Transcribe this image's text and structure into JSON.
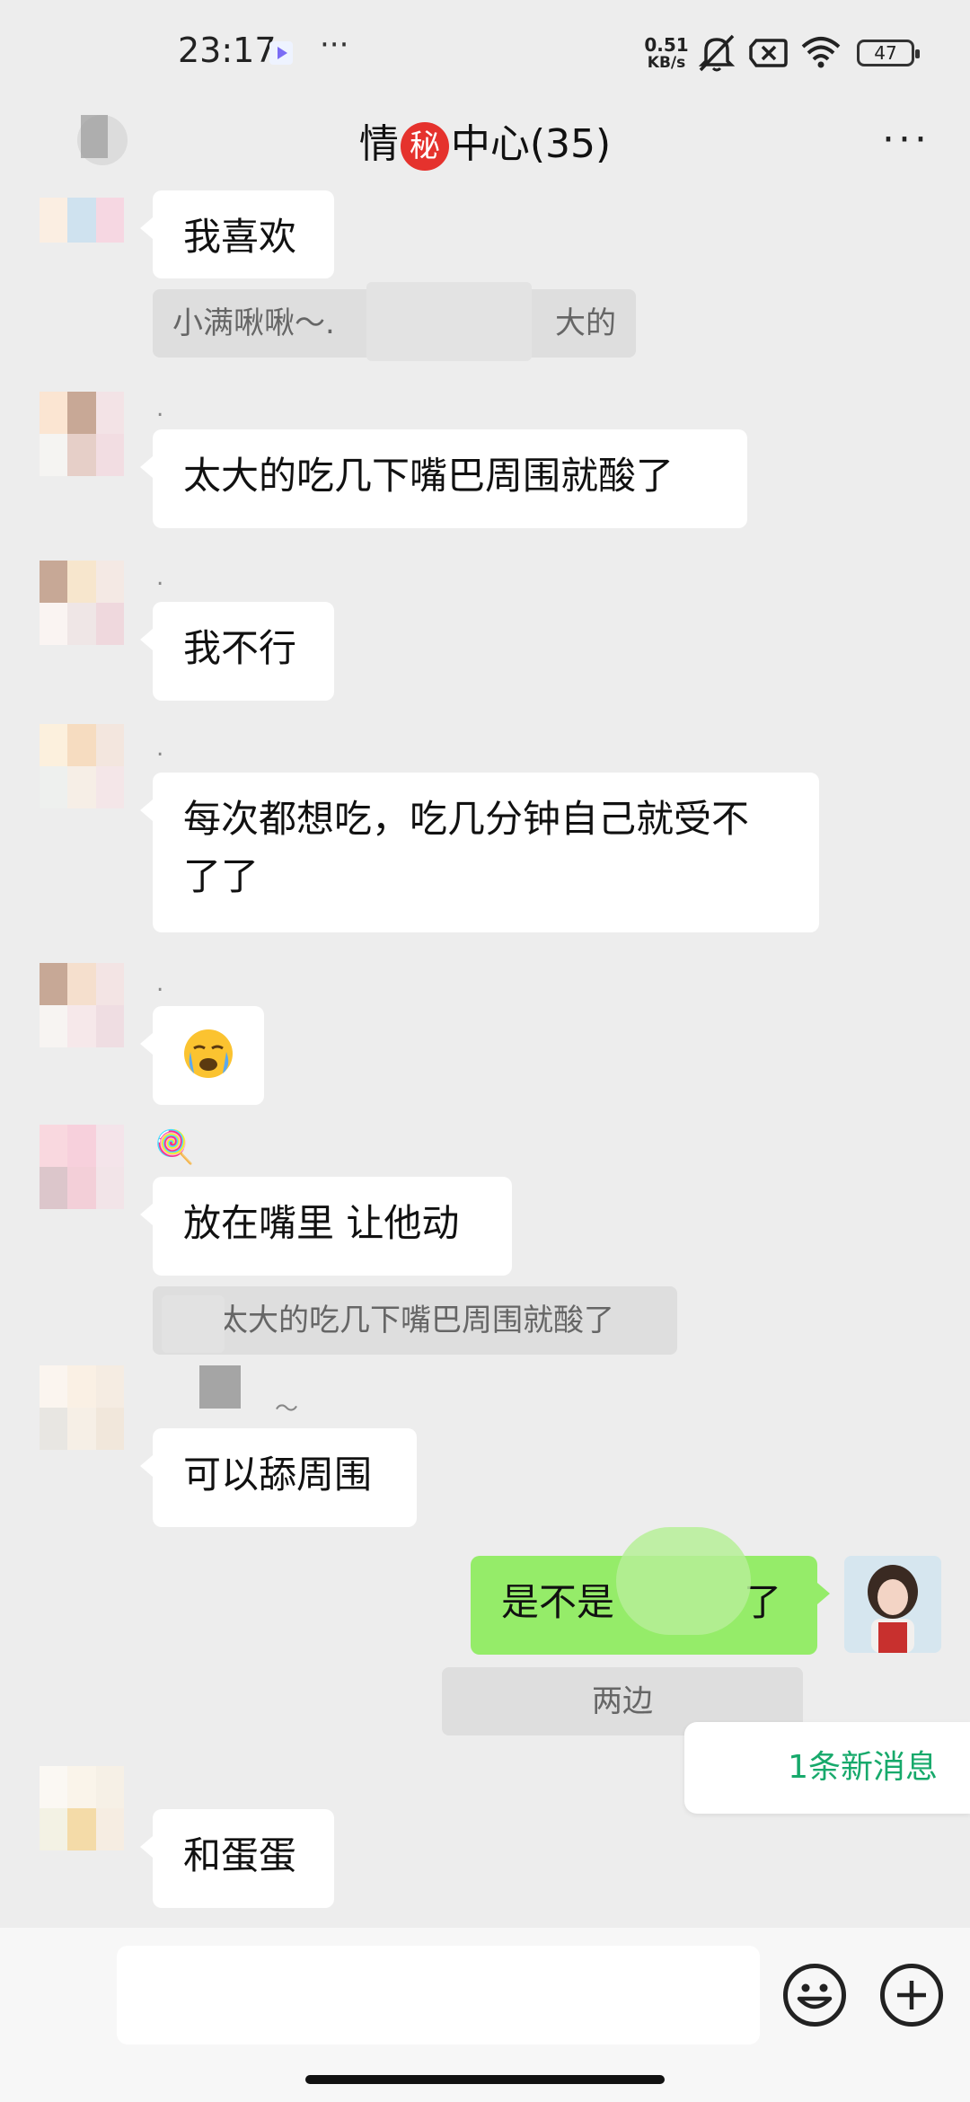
{
  "status_bar": {
    "time": "23:17",
    "more": "···",
    "net_speed_value": "0.51",
    "net_speed_unit": "KB/s",
    "battery": "47"
  },
  "header": {
    "title_left": "情",
    "title_badge": "秘",
    "title_right": "中心(35)",
    "more": "···"
  },
  "messages": [
    {
      "text": "我喜欢"
    },
    {
      "quote_left": "小满啾啾～.",
      "quote_right": "大的"
    },
    {
      "nick": ".",
      "text": "太大的吃几下嘴巴周围就酸了"
    },
    {
      "nick": ".",
      "text": "我不行"
    },
    {
      "nick": ".",
      "text_line1": "每次都想吃，吃几分钟自己就受不",
      "text_line2": "了了"
    },
    {
      "nick": ".",
      "emoji": "😭"
    },
    {
      "nick": "🍭",
      "text": "放在嘴里 让他动"
    },
    {
      "quote": "太大的吃几下嘴巴周围就酸了"
    },
    {
      "nick": "～",
      "text": "可以舔周围"
    },
    {
      "text": "是不是",
      "text_tail": "了"
    },
    {
      "quote": "两边"
    },
    {
      "text": "和蛋蛋"
    }
  ],
  "new_messages": "1条新消息",
  "input": {
    "placeholder": ""
  },
  "colors": {
    "background": "#ededed",
    "my_bubble": "#95ec69",
    "other_bubble": "#ffffff",
    "new_message_text": "#17a96b",
    "badge": "#e5322d"
  }
}
